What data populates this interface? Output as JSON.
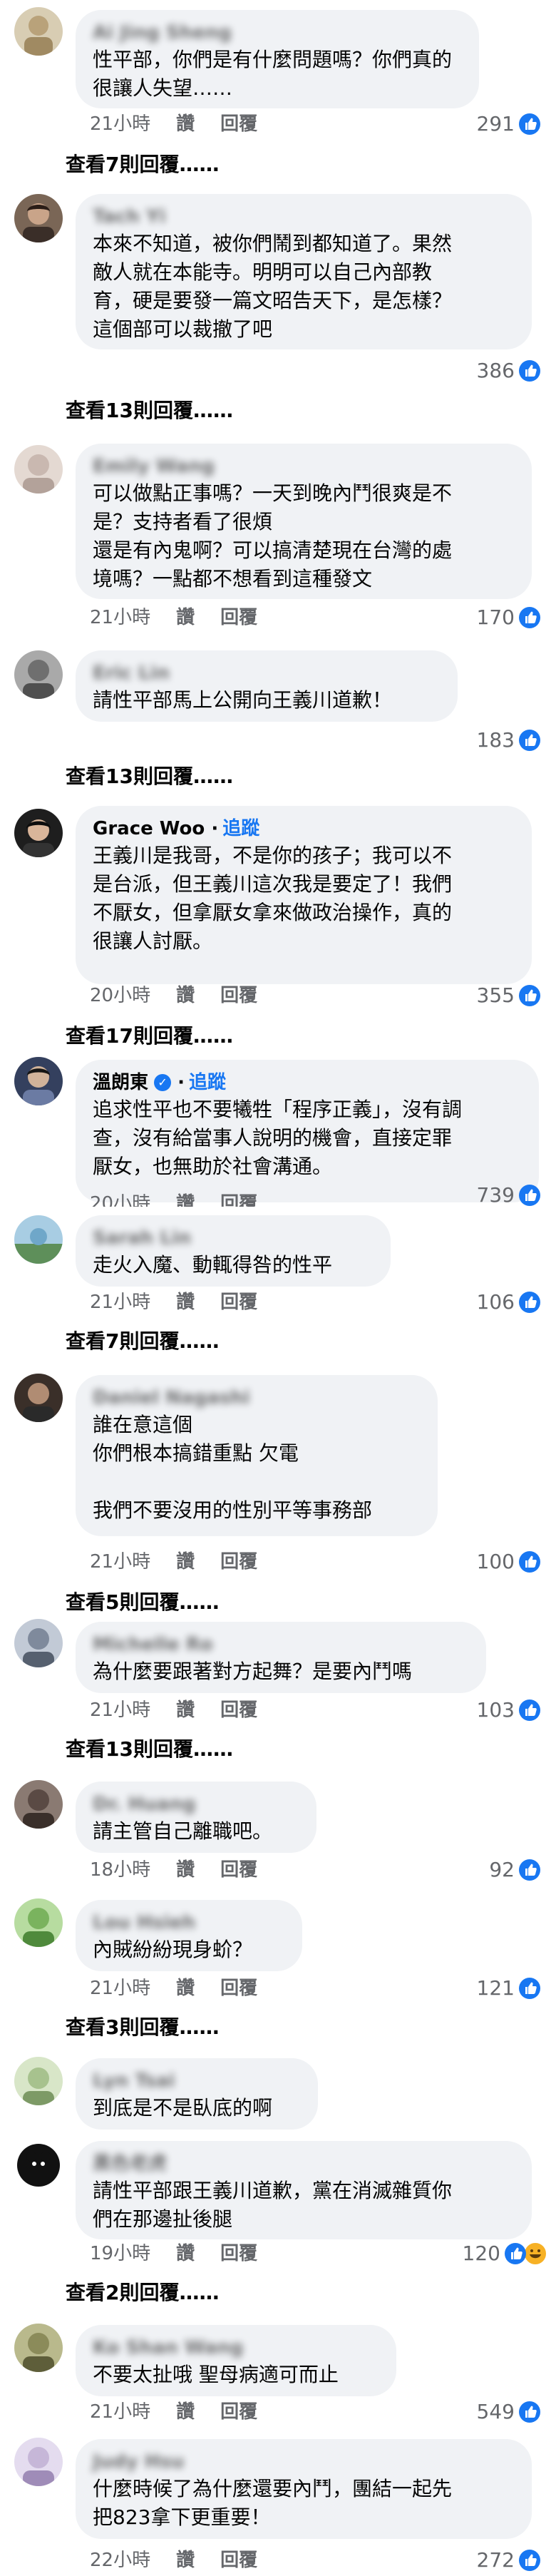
{
  "actions": {
    "like": "讚",
    "reply": "回覆"
  },
  "comments": [
    {
      "author": "Ai Jing Sheng",
      "text": "性平部，你們是有什麼問題嗎？你們真的\n很讓人失望……",
      "time": "21小時",
      "reactions": "291",
      "replies_link": "查看7則回覆……",
      "avatar_color": "#b9a27a"
    },
    {
      "author": "Tach Yi",
      "text": "本來不知道，被你們鬧到都知道了。果然\n敵人就在本能寺。明明可以自己內部教\n育，硬是要發一篇文昭告天下，是怎樣？\n這個部可以裁撤了吧",
      "time": "21小時",
      "reactions": "386",
      "replies_link": "查看13則回覆……",
      "avatar_color": "#5b4a3e"
    },
    {
      "author": "Emily Wang",
      "text": "可以做點正事嗎？一天到晚內鬥很爽是不\n是？支持者看了很煩\n還是有內鬼啊？可以搞清楚現在台灣的處\n境嗎？一點都不想看到這種發文",
      "time": "21小時",
      "reactions": "170",
      "replies_link": "",
      "avatar_color": "#c9b8b0"
    },
    {
      "author": "Eric Lin",
      "text": "請性平部馬上公開向王義川道歉！",
      "time": "21小時",
      "reactions": "183",
      "replies_link": "查看13則回覆……",
      "avatar_color": "#8c8c8c"
    },
    {
      "author": "Grace Woo",
      "follow": "追蹤",
      "text": "王義川是我哥，不是你的孩子；我可以不\n是台派，但王義川這次我是要定了！我們\n不厭女，但拿厭女拿來做政治操作，真的\n很讓人討厭。",
      "time": "20小時",
      "reactions": "355",
      "replies_link": "查看17則回覆……",
      "avatar_color": "#2b2b2b"
    },
    {
      "author": "溫朗東",
      "follow": "追蹤",
      "text": "追求性平也不要犧牲「程序正義」，沒有調\n查，沒有給當事人說明的機會，直接定罪\n厭女，也無助於社會溝通。",
      "time": "20小時",
      "reactions": "739",
      "replies_link": "",
      "avatar_color": "#3d4a6b"
    },
    {
      "author": "Sarah Lin",
      "text": "走火入魔、動輒得咎的性平",
      "time": "21小時",
      "reactions": "106",
      "replies_link": "查看7則回覆……",
      "avatar_color": "#6fa7c9"
    },
    {
      "author": "Daniel Nagashi",
      "text": "誰在意這個\n你們根本搞錯重點 欠電\n\n我們不要沒用的性別平等事務部",
      "time": "21小時",
      "reactions": "100",
      "replies_link": "查看5則回覆……",
      "avatar_color": "#4a3a32"
    },
    {
      "author": "Michelle Ro",
      "text": "為什麼要跟著對方起舞？是要內鬥嗎",
      "time": "21小時",
      "reactions": "103",
      "replies_link": "查看13則回覆……",
      "avatar_color": "#9aa4b4"
    },
    {
      "author": "Dr. Huang",
      "text": "請主管自己離職吧。",
      "time": "18小時",
      "reactions": "92",
      "replies_link": "",
      "avatar_color": "#5a4a44"
    },
    {
      "author": "Lou Hsieh",
      "text": "內賊紛紛現身蚧？",
      "time": "21小時",
      "reactions": "121",
      "replies_link": "查看3則回覆……",
      "avatar_color": "#7ab35e"
    },
    {
      "author": "Lyn Tsai",
      "text": "到底是不是臥底的啊",
      "time": "",
      "reactions": "",
      "replies_link": "",
      "avatar_color": "#a7c28e"
    },
    {
      "author": "黑色老虎",
      "text": "請性平部跟王義川道歉，黨在消滅雜質你\n們在那邊扯後腿",
      "time": "19小時",
      "reactions": "120",
      "replies_link": "查看2則回覆……",
      "avatar_color": "#111111",
      "haha": true
    },
    {
      "author": "Ko Shan Wang",
      "text": "不要太扯哦 聖母病適可而止",
      "time": "21小時",
      "reactions": "549",
      "replies_link": "",
      "avatar_color": "#8b8b5a"
    },
    {
      "author": "Judy Hsu",
      "text": "什麼時候了為什麼還要內鬥，團結一起先\n把823拿下更重要！",
      "time": "22小時",
      "reactions": "272",
      "replies_link": "",
      "avatar_color": "#c6b7d8"
    }
  ]
}
